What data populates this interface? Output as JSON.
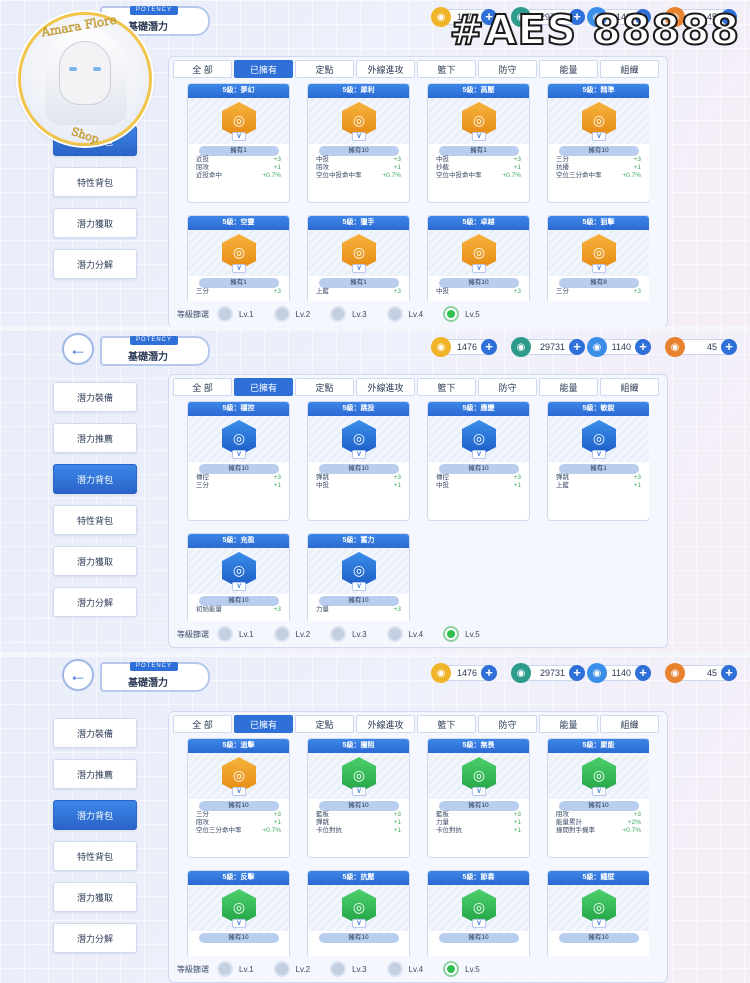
{
  "overlay": {
    "text": "#AES 88888"
  },
  "logo": {
    "top_text": "Amara Flore",
    "bottom_text": "Shop"
  },
  "header": {
    "tag": "POTENCY",
    "title": "基礎潛力",
    "back_icon": "back-arrow-icon"
  },
  "currencies": [
    {
      "name": "gold-coin-icon",
      "value": "1476",
      "color": "#f0b428"
    },
    {
      "name": "spiral-token-icon",
      "value": "29731",
      "color": "#2e9a8a"
    },
    {
      "name": "diamond-icon",
      "value": "1140",
      "color": "#3a8ee8"
    },
    {
      "name": "ticket-icon",
      "value": "45",
      "color": "#e8822e"
    }
  ],
  "sidebar": {
    "items": [
      {
        "label": "潛力裝備"
      },
      {
        "label": "潛力推薦"
      },
      {
        "label": "潛力背包"
      },
      {
        "label": "特性背包"
      },
      {
        "label": "潛力獲取"
      },
      {
        "label": "潛力分解"
      }
    ],
    "active_index": 2
  },
  "tabs": [
    "全 部",
    "已擁有",
    "定點",
    "外線進攻",
    "籃下",
    "防守",
    "能量",
    "組織"
  ],
  "active_tab": 1,
  "levels": {
    "label": "等級篩選",
    "items": [
      "Lv.1",
      "Lv.2",
      "Lv.3",
      "Lv.4",
      "Lv.5"
    ],
    "selected": "Lv.5"
  },
  "screens": [
    {
      "cards": [
        {
          "title": "5級：夢幻",
          "icon": "orange",
          "owned": "擁有1",
          "stats": [
            [
              "近投",
              "+3"
            ],
            [
              "阻攻",
              "+1"
            ],
            [
              "近投命中",
              "+0.7%"
            ]
          ]
        },
        {
          "title": "5級：犀利",
          "icon": "orange",
          "owned": "擁有10",
          "stats": [
            [
              "中投",
              "+3"
            ],
            [
              "阻攻",
              "+1"
            ],
            [
              "空位中投命中率",
              "+0.7%"
            ]
          ]
        },
        {
          "title": "5級：高壓",
          "icon": "orange",
          "owned": "擁有1",
          "stats": [
            [
              "中投",
              "+3"
            ],
            [
              "抄截",
              "+1"
            ],
            [
              "空位中投命中率",
              "+0.7%"
            ]
          ]
        },
        {
          "title": "5級：精準",
          "icon": "orange",
          "owned": "擁有10",
          "stats": [
            [
              "三分",
              "+3"
            ],
            [
              "抗擾",
              "+1"
            ],
            [
              "空位三分命中率",
              "+0.7%"
            ]
          ]
        },
        {
          "title": "5級：空靈",
          "icon": "orange",
          "owned": "擁有1",
          "stats": [
            [
              "三分",
              "+3"
            ]
          ]
        },
        {
          "title": "5級：獵手",
          "icon": "orange",
          "owned": "擁有1",
          "stats": [
            [
              "上籃",
              "+3"
            ]
          ]
        },
        {
          "title": "5級：卓越",
          "icon": "orange",
          "owned": "擁有10",
          "stats": [
            [
              "中投",
              "+3"
            ]
          ]
        },
        {
          "title": "5級：狙擊",
          "icon": "orange",
          "owned": "擁有8",
          "stats": [
            [
              "三分",
              "+3"
            ]
          ]
        }
      ]
    },
    {
      "cards": [
        {
          "title": "5級：穩控",
          "icon": "blue",
          "owned": "擁有10",
          "stats": [
            [
              "傳控",
              "+3"
            ],
            [
              "三分",
              "+1"
            ]
          ]
        },
        {
          "title": "5級：跳投",
          "icon": "blue",
          "owned": "擁有10",
          "stats": [
            [
              "彈跳",
              "+3"
            ],
            [
              "中投",
              "+1"
            ]
          ]
        },
        {
          "title": "5級：應變",
          "icon": "blue",
          "owned": "擁有10",
          "stats": [
            [
              "傳控",
              "+3"
            ],
            [
              "中投",
              "+1"
            ]
          ]
        },
        {
          "title": "5級：敏銳",
          "icon": "blue",
          "owned": "擁有1",
          "stats": [
            [
              "彈跳",
              "+3"
            ],
            [
              "上籃",
              "+1"
            ]
          ]
        },
        {
          "title": "5級：充盈",
          "icon": "blue",
          "owned": "擁有10",
          "stats": [
            [
              "初始能量",
              "+3"
            ]
          ]
        },
        {
          "title": "5級：蓄力",
          "icon": "blue",
          "owned": "擁有10",
          "stats": [
            [
              "力量",
              "+3"
            ]
          ]
        }
      ]
    },
    {
      "cards": [
        {
          "title": "5級：追擊",
          "icon": "orange",
          "owned": "擁有10",
          "stats": [
            [
              "三分",
              "+3"
            ],
            [
              "阻攻",
              "+1"
            ],
            [
              "空位三分命中率",
              "+0.7%"
            ]
          ]
        },
        {
          "title": "5級：攔阻",
          "icon": "green",
          "owned": "擁有10",
          "stats": [
            [
              "籃板",
              "+3"
            ],
            [
              "彈跳",
              "+1"
            ],
            [
              "卡位對抗",
              "+1"
            ]
          ]
        },
        {
          "title": "5級：無畏",
          "icon": "green",
          "owned": "擁有10",
          "stats": [
            [
              "籃板",
              "+3"
            ],
            [
              "力量",
              "+1"
            ],
            [
              "卡位對抗",
              "+1"
            ]
          ]
        },
        {
          "title": "5級：聚能",
          "icon": "green",
          "owned": "擁有10",
          "stats": [
            [
              "阻攻",
              "+3"
            ],
            [
              "能量累計",
              "+2%"
            ],
            [
              "撞開對手機率",
              "+0.7%"
            ]
          ]
        },
        {
          "title": "5級：反擊",
          "icon": "green",
          "owned": "擁有10",
          "stats": []
        },
        {
          "title": "5級：抗壓",
          "icon": "green",
          "owned": "擁有10",
          "stats": []
        },
        {
          "title": "5級：節奏",
          "icon": "green",
          "owned": "擁有10",
          "stats": []
        },
        {
          "title": "5級：鐵壁",
          "icon": "green",
          "owned": "擁有10",
          "stats": []
        }
      ]
    }
  ]
}
